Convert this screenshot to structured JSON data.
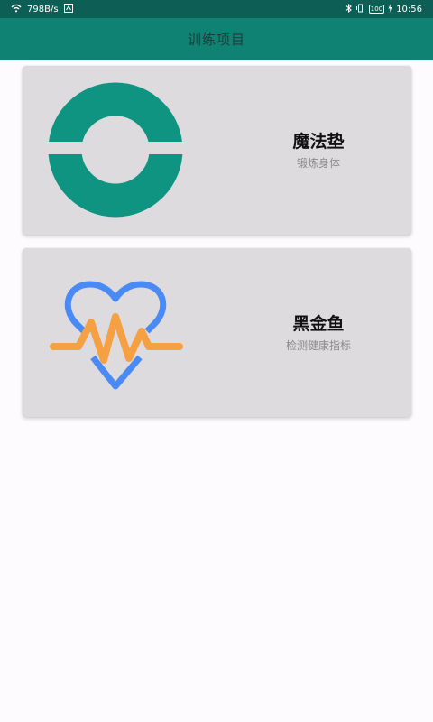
{
  "status_bar": {
    "speed": "798B/s",
    "battery": "100",
    "time": "10:56"
  },
  "app_bar": {
    "title": "训练项目"
  },
  "cards": [
    {
      "title": "魔法垫",
      "subtitle": "锻炼身体",
      "icon": "ring-mat-icon",
      "icon_color": "#0f9482"
    },
    {
      "title": "黑金鱼",
      "subtitle": "检测健康指标",
      "icon": "heart-pulse-icon",
      "icon_colors": [
        "#4a8af4",
        "#f4a043"
      ]
    }
  ],
  "colors": {
    "status_bar": "#0d5f55",
    "app_bar": "#0f8274",
    "card_bg": "#dedbde",
    "page_bg": "#fdfbfd"
  }
}
